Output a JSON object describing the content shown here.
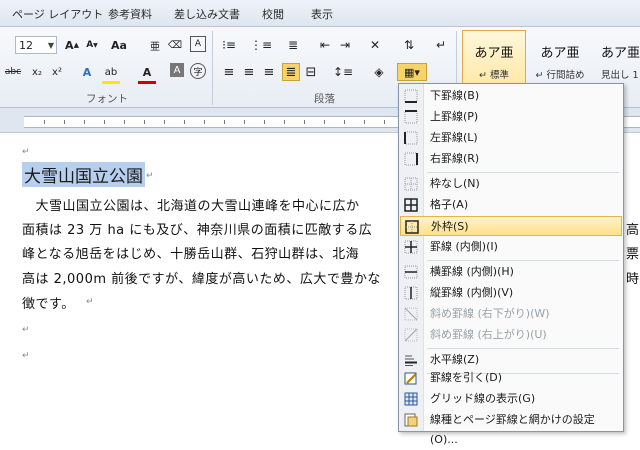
{
  "tabs": [
    "ページ レイアウト",
    "参考資料",
    "差し込み文書",
    "校閲",
    "表示"
  ],
  "ribbon": {
    "font_size": "12",
    "font_group_label": "フォント",
    "paragraph_group_label": "段落",
    "styles": [
      {
        "sample": "あア亜",
        "name": "↵ 標準"
      },
      {
        "sample": "あア亜",
        "name": "↵ 行間詰め"
      },
      {
        "sample": "あア亜",
        "name": "見出し 1"
      }
    ]
  },
  "document": {
    "title": "大雪山国立公園",
    "lines": [
      "　大雪山国立公園は、北海道の大雪山連峰を中心に広か",
      "面積は 23 万 ha にも及び、神奈川県の面積に匹敵する広",
      "峰となる旭岳をはじめ、十勝岳山群、石狩山群は、北海",
      "高は 2,000m 前後ですが、緯度が高いため、広大で豊かな",
      "徴です。"
    ],
    "right_fragments": [
      "高",
      "票",
      "時"
    ]
  },
  "menu": {
    "items": [
      {
        "label": "下罫線(B)",
        "icon": "bottom-border-icon",
        "disabled": false
      },
      {
        "label": "上罫線(P)",
        "icon": "top-border-icon",
        "disabled": false
      },
      {
        "label": "左罫線(L)",
        "icon": "left-border-icon",
        "disabled": false
      },
      {
        "label": "右罫線(R)",
        "icon": "right-border-icon",
        "disabled": false
      },
      {
        "label": "枠なし(N)",
        "icon": "no-border-icon",
        "disabled": false
      },
      {
        "label": "格子(A)",
        "icon": "all-borders-icon",
        "disabled": false
      },
      {
        "label": "外枠(S)",
        "icon": "outside-borders-icon",
        "disabled": false,
        "highlighted": true
      },
      {
        "label": "罫線 (内側)(I)",
        "icon": "inside-borders-icon",
        "disabled": false
      },
      {
        "label": "横罫線 (内側)(H)",
        "icon": "inside-horizontal-border-icon",
        "disabled": false
      },
      {
        "label": "縦罫線 (内側)(V)",
        "icon": "inside-vertical-border-icon",
        "disabled": false
      },
      {
        "label": "斜め罫線 (右下がり)(W)",
        "icon": "diagonal-down-border-icon",
        "disabled": true
      },
      {
        "label": "斜め罫線 (右上がり)(U)",
        "icon": "diagonal-up-border-icon",
        "disabled": true
      },
      {
        "label": "水平線(Z)",
        "icon": "horizontal-line-icon",
        "disabled": false
      },
      {
        "label": "罫線を引く(D)",
        "icon": "draw-table-icon",
        "disabled": false
      },
      {
        "label": "グリッド線の表示(G)",
        "icon": "view-gridlines-icon",
        "disabled": false
      },
      {
        "label": "線種とページ罫線と網かけの設定(O)...",
        "icon": "borders-shading-icon",
        "disabled": false
      }
    ]
  },
  "colors": {
    "highlight": "#f6d46a",
    "selection": "#b7cfee",
    "accent": "#2b579a"
  }
}
